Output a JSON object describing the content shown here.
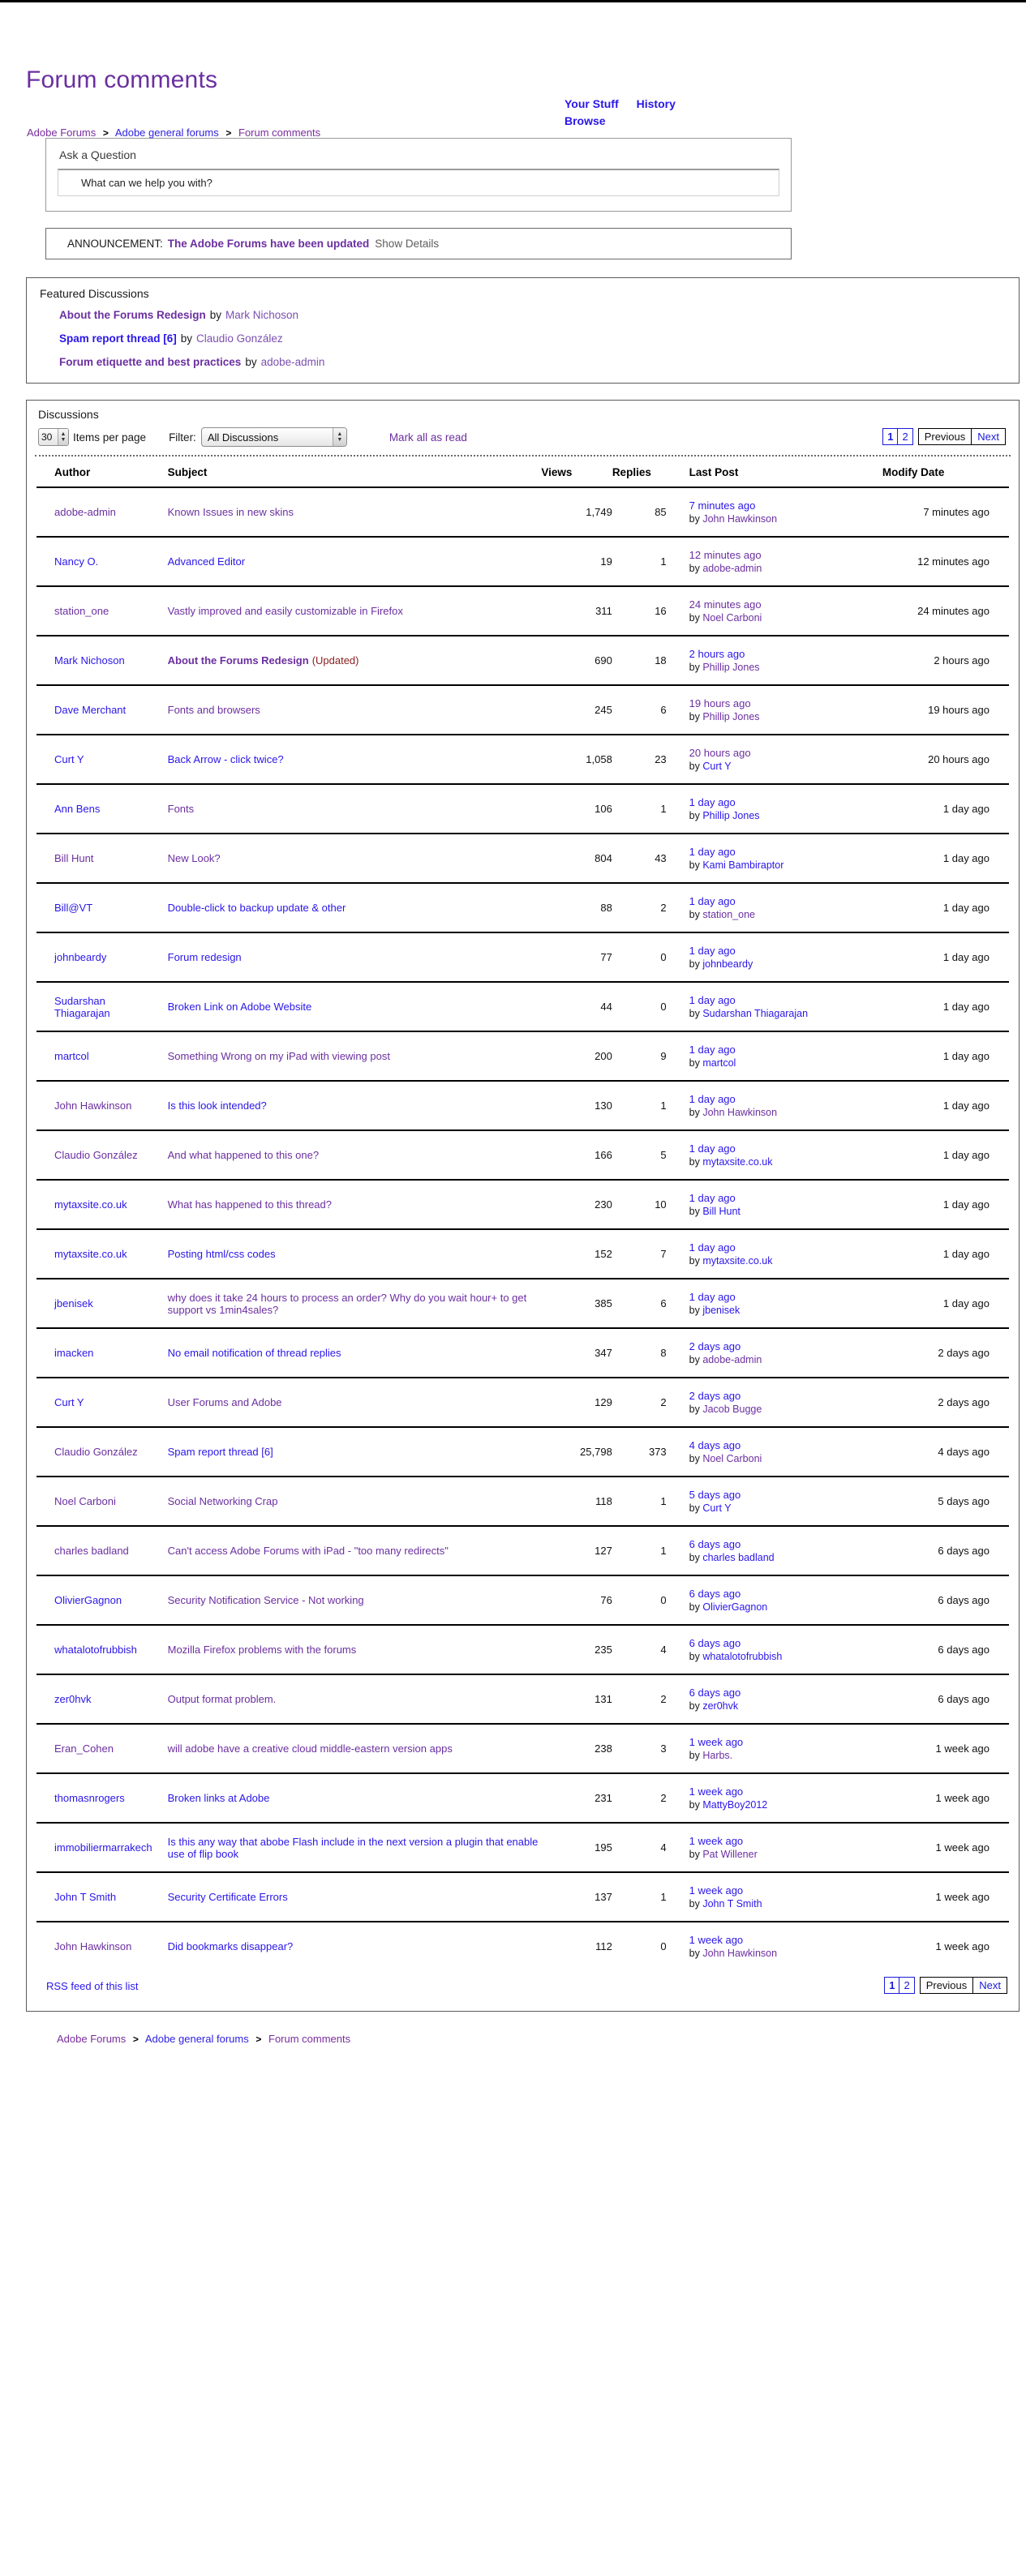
{
  "header": {
    "title": "Forum comments",
    "breadcrumb": [
      {
        "label": "Adobe Forums",
        "visited": true
      },
      {
        "label": "Adobe general forums",
        "visited": false
      },
      {
        "label": "Forum comments",
        "visited": true
      }
    ],
    "separator": ">",
    "usernav": [
      {
        "label": "Your Stuff"
      },
      {
        "label": "History"
      },
      {
        "label": "Browse"
      }
    ]
  },
  "ask": {
    "label": "Ask a Question",
    "placeholder": "What can we help you with?",
    "value": ""
  },
  "announcement": {
    "lead": "ANNOUNCEMENT:",
    "headline": "The Adobe Forums have been updated",
    "show_details": "Show Details"
  },
  "featured": {
    "title": "Featured Discussions",
    "by_word": "by",
    "items": [
      {
        "title": "About the Forums Redesign",
        "author": "Mark Nichoson",
        "title_blue": false,
        "author_blue": false
      },
      {
        "title": "Spam report thread [6]",
        "author": "Claudio González",
        "title_blue": true,
        "author_blue": false
      },
      {
        "title": "Forum etiquette and best practices",
        "author": "adobe-admin",
        "title_blue": false,
        "author_blue": false
      }
    ]
  },
  "discussions": {
    "title": "Discussions",
    "items_per_page_value": "30",
    "items_per_page_label": "Items per page",
    "filter_label": "Filter:",
    "filter_value": "All Discussions",
    "mark_all_as_read": "Mark all as read",
    "pager": {
      "pages": [
        "1",
        "2"
      ],
      "current": "1",
      "previous": "Previous",
      "next": "Next"
    },
    "columns": [
      "Author",
      "Subject",
      "Views",
      "Replies",
      "Last Post",
      "Modify Date"
    ],
    "by_word": "by",
    "rows": [
      {
        "author": "adobe-admin",
        "author_blue": false,
        "subject": "Known Issues in new skins",
        "subject_blue": false,
        "subject_bold": false,
        "updated": "",
        "views": "1,749",
        "replies": "85",
        "last_time": "7 minutes ago",
        "last_time_blue": true,
        "last_by": "John Hawkinson",
        "last_by_blue": false,
        "modify": "7 minutes ago"
      },
      {
        "author": "Nancy O.",
        "author_blue": true,
        "subject": "Advanced Editor",
        "subject_blue": true,
        "subject_bold": false,
        "updated": "",
        "views": "19",
        "replies": "1",
        "last_time": "12 minutes ago",
        "last_time_blue": false,
        "last_by": "adobe-admin",
        "last_by_blue": false,
        "modify": "12 minutes ago"
      },
      {
        "author": "station_one",
        "author_blue": false,
        "subject": "Vastly improved and easily customizable in Firefox",
        "subject_blue": false,
        "subject_bold": false,
        "updated": "",
        "views": "311",
        "replies": "16",
        "last_time": "24 minutes ago",
        "last_time_blue": false,
        "last_by": "Noel Carboni",
        "last_by_blue": false,
        "modify": "24 minutes ago"
      },
      {
        "author": "Mark Nichoson",
        "author_blue": true,
        "subject": "About the Forums Redesign",
        "subject_blue": false,
        "subject_bold": true,
        "updated": "(Updated)",
        "views": "690",
        "replies": "18",
        "last_time": "2 hours ago",
        "last_time_blue": true,
        "last_by": "Phillip Jones",
        "last_by_blue": false,
        "modify": "2 hours ago"
      },
      {
        "author": "Dave Merchant",
        "author_blue": true,
        "subject": "Fonts and browsers",
        "subject_blue": false,
        "subject_bold": false,
        "updated": "",
        "views": "245",
        "replies": "6",
        "last_time": "19 hours ago",
        "last_time_blue": false,
        "last_by": "Phillip Jones",
        "last_by_blue": false,
        "modify": "19 hours ago"
      },
      {
        "author": "Curt Y",
        "author_blue": true,
        "subject": "Back Arrow - click twice?",
        "subject_blue": true,
        "subject_bold": false,
        "updated": "",
        "views": "1,058",
        "replies": "23",
        "last_time": "20 hours ago",
        "last_time_blue": false,
        "last_by": "Curt Y",
        "last_by_blue": true,
        "modify": "20 hours ago"
      },
      {
        "author": "Ann Bens",
        "author_blue": true,
        "subject": "Fonts",
        "subject_blue": false,
        "subject_bold": false,
        "updated": "",
        "views": "106",
        "replies": "1",
        "last_time": "1 day ago",
        "last_time_blue": true,
        "last_by": "Phillip Jones",
        "last_by_blue": true,
        "modify": "1 day ago"
      },
      {
        "author": "Bill Hunt",
        "author_blue": false,
        "subject": "New Look?",
        "subject_blue": false,
        "subject_bold": false,
        "updated": "",
        "views": "804",
        "replies": "43",
        "last_time": "1 day ago",
        "last_time_blue": true,
        "last_by": "Kami Bambiraptor",
        "last_by_blue": true,
        "modify": "1 day ago"
      },
      {
        "author": "Bill@VT",
        "author_blue": true,
        "subject": "Double-click to backup update & other",
        "subject_blue": true,
        "subject_bold": false,
        "updated": "",
        "views": "88",
        "replies": "2",
        "last_time": "1 day ago",
        "last_time_blue": true,
        "last_by": "station_one",
        "last_by_blue": false,
        "modify": "1 day ago"
      },
      {
        "author": "johnbeardy",
        "author_blue": true,
        "subject": "Forum redesign",
        "subject_blue": true,
        "subject_bold": false,
        "updated": "",
        "views": "77",
        "replies": "0",
        "last_time": "1 day ago",
        "last_time_blue": true,
        "last_by": "johnbeardy",
        "last_by_blue": true,
        "modify": "1 day ago"
      },
      {
        "author": "Sudarshan Thiagarajan",
        "author_blue": true,
        "subject": "Broken Link on Adobe Website",
        "subject_blue": true,
        "subject_bold": false,
        "updated": "",
        "views": "44",
        "replies": "0",
        "last_time": "1 day ago",
        "last_time_blue": true,
        "last_by": "Sudarshan Thiagarajan",
        "last_by_blue": true,
        "modify": "1 day ago"
      },
      {
        "author": "martcol",
        "author_blue": true,
        "subject": "Something Wrong on my iPad with viewing post",
        "subject_blue": false,
        "subject_bold": false,
        "updated": "",
        "views": "200",
        "replies": "9",
        "last_time": "1 day ago",
        "last_time_blue": true,
        "last_by": "martcol",
        "last_by_blue": true,
        "modify": "1 day ago"
      },
      {
        "author": "John Hawkinson",
        "author_blue": false,
        "subject": "Is this look intended?",
        "subject_blue": true,
        "subject_bold": false,
        "updated": "",
        "views": "130",
        "replies": "1",
        "last_time": "1 day ago",
        "last_time_blue": true,
        "last_by": "John Hawkinson",
        "last_by_blue": false,
        "modify": "1 day ago"
      },
      {
        "author": "Claudio González",
        "author_blue": false,
        "subject": "And what happened to this one?",
        "subject_blue": false,
        "subject_bold": false,
        "updated": "",
        "views": "166",
        "replies": "5",
        "last_time": "1 day ago",
        "last_time_blue": true,
        "last_by": "mytaxsite.co.uk",
        "last_by_blue": true,
        "modify": "1 day ago"
      },
      {
        "author": "mytaxsite.co.uk",
        "author_blue": true,
        "subject": "What has happened to this thread?",
        "subject_blue": false,
        "subject_bold": false,
        "updated": "",
        "views": "230",
        "replies": "10",
        "last_time": "1 day ago",
        "last_time_blue": true,
        "last_by": "Bill Hunt",
        "last_by_blue": true,
        "modify": "1 day ago"
      },
      {
        "author": "mytaxsite.co.uk",
        "author_blue": true,
        "subject": "Posting html/css codes",
        "subject_blue": true,
        "subject_bold": false,
        "updated": "",
        "views": "152",
        "replies": "7",
        "last_time": "1 day ago",
        "last_time_blue": true,
        "last_by": "mytaxsite.co.uk",
        "last_by_blue": true,
        "modify": "1 day ago"
      },
      {
        "author": "jbenisek",
        "author_blue": true,
        "subject": "why does it take 24 hours to process an order? Why do you wait hour+ to get support vs 1min4sales?",
        "subject_blue": false,
        "subject_bold": false,
        "updated": "",
        "views": "385",
        "replies": "6",
        "last_time": "1 day ago",
        "last_time_blue": true,
        "last_by": "jbenisek",
        "last_by_blue": true,
        "modify": "1 day ago"
      },
      {
        "author": "imacken",
        "author_blue": true,
        "subject": "No email notification of thread replies",
        "subject_blue": true,
        "subject_bold": false,
        "updated": "",
        "views": "347",
        "replies": "8",
        "last_time": "2 days ago",
        "last_time_blue": true,
        "last_by": "adobe-admin",
        "last_by_blue": false,
        "modify": "2 days ago"
      },
      {
        "author": "Curt Y",
        "author_blue": true,
        "subject": "User Forums and Adobe",
        "subject_blue": false,
        "subject_bold": false,
        "updated": "",
        "views": "129",
        "replies": "2",
        "last_time": "2 days ago",
        "last_time_blue": true,
        "last_by": "Jacob Bugge",
        "last_by_blue": false,
        "modify": "2 days ago"
      },
      {
        "author": "Claudio González",
        "author_blue": false,
        "subject": "Spam report thread [6]",
        "subject_blue": true,
        "subject_bold": false,
        "updated": "",
        "views": "25,798",
        "replies": "373",
        "last_time": "4 days ago",
        "last_time_blue": true,
        "last_by": "Noel Carboni",
        "last_by_blue": false,
        "modify": "4 days ago"
      },
      {
        "author": "Noel Carboni",
        "author_blue": false,
        "subject": "Social Networking Crap",
        "subject_blue": false,
        "subject_bold": false,
        "updated": "",
        "views": "118",
        "replies": "1",
        "last_time": "5 days ago",
        "last_time_blue": true,
        "last_by": "Curt Y",
        "last_by_blue": true,
        "modify": "5 days ago"
      },
      {
        "author": "charles badland",
        "author_blue": false,
        "subject": "Can't access Adobe Forums with iPad - \"too many redirects\"",
        "subject_blue": false,
        "subject_bold": false,
        "updated": "",
        "views": "127",
        "replies": "1",
        "last_time": "6 days ago",
        "last_time_blue": true,
        "last_by": "charles badland",
        "last_by_blue": true,
        "modify": "6 days ago"
      },
      {
        "author": "OlivierGagnon",
        "author_blue": true,
        "subject": "Security Notification Service - Not working",
        "subject_blue": false,
        "subject_bold": false,
        "updated": "",
        "views": "76",
        "replies": "0",
        "last_time": "6 days ago",
        "last_time_blue": true,
        "last_by": "OlivierGagnon",
        "last_by_blue": true,
        "modify": "6 days ago"
      },
      {
        "author": "whatalotofrubbish",
        "author_blue": true,
        "subject": "Mozilla Firefox problems with the forums",
        "subject_blue": false,
        "subject_bold": false,
        "updated": "",
        "views": "235",
        "replies": "4",
        "last_time": "6 days ago",
        "last_time_blue": true,
        "last_by": "whatalotofrubbish",
        "last_by_blue": true,
        "modify": "6 days ago"
      },
      {
        "author": "zer0hvk",
        "author_blue": true,
        "subject": "Output format problem.",
        "subject_blue": false,
        "subject_bold": false,
        "updated": "",
        "views": "131",
        "replies": "2",
        "last_time": "6 days ago",
        "last_time_blue": true,
        "last_by": "zer0hvk",
        "last_by_blue": true,
        "modify": "6 days ago"
      },
      {
        "author": "Eran_Cohen",
        "author_blue": false,
        "subject": "will adobe have a creative cloud middle-eastern version apps",
        "subject_blue": false,
        "subject_bold": false,
        "updated": "",
        "views": "238",
        "replies": "3",
        "last_time": "1 week ago",
        "last_time_blue": true,
        "last_by": "Harbs.",
        "last_by_blue": false,
        "modify": "1 week ago"
      },
      {
        "author": "thomasnrogers",
        "author_blue": true,
        "subject": "Broken links at Adobe",
        "subject_blue": true,
        "subject_bold": false,
        "updated": "",
        "views": "231",
        "replies": "2",
        "last_time": "1 week ago",
        "last_time_blue": true,
        "last_by": "MattyBoy2012",
        "last_by_blue": true,
        "modify": "1 week ago"
      },
      {
        "author": "immobiliermarrakech",
        "author_blue": true,
        "subject": "Is this any way that abobe Flash include in the next version a plugin that enable use of flip book",
        "subject_blue": true,
        "subject_bold": false,
        "updated": "",
        "views": "195",
        "replies": "4",
        "last_time": "1 week ago",
        "last_time_blue": true,
        "last_by": "Pat Willener",
        "last_by_blue": false,
        "modify": "1 week ago"
      },
      {
        "author": "John T Smith",
        "author_blue": true,
        "subject": "Security Certificate Errors",
        "subject_blue": true,
        "subject_bold": false,
        "updated": "",
        "views": "137",
        "replies": "1",
        "last_time": "1 week ago",
        "last_time_blue": true,
        "last_by": "John T Smith",
        "last_by_blue": true,
        "modify": "1 week ago"
      },
      {
        "author": "John Hawkinson",
        "author_blue": false,
        "subject": "Did bookmarks disappear?",
        "subject_blue": true,
        "subject_bold": false,
        "updated": "",
        "views": "112",
        "replies": "0",
        "last_time": "1 week ago",
        "last_time_blue": true,
        "last_by": "John Hawkinson",
        "last_by_blue": false,
        "modify": "1 week ago"
      }
    ],
    "rss_label": "RSS feed of this list"
  },
  "footer": {
    "breadcrumb": [
      {
        "label": "Adobe Forums",
        "visited": true
      },
      {
        "label": "Adobe general forums",
        "visited": false
      },
      {
        "label": "Forum comments",
        "visited": true
      }
    ],
    "separator": ">"
  },
  "colors": {
    "visited_link": "#6b2fa0",
    "unvisited_link": "#2a16e8",
    "updated_flag": "#8a2020"
  }
}
